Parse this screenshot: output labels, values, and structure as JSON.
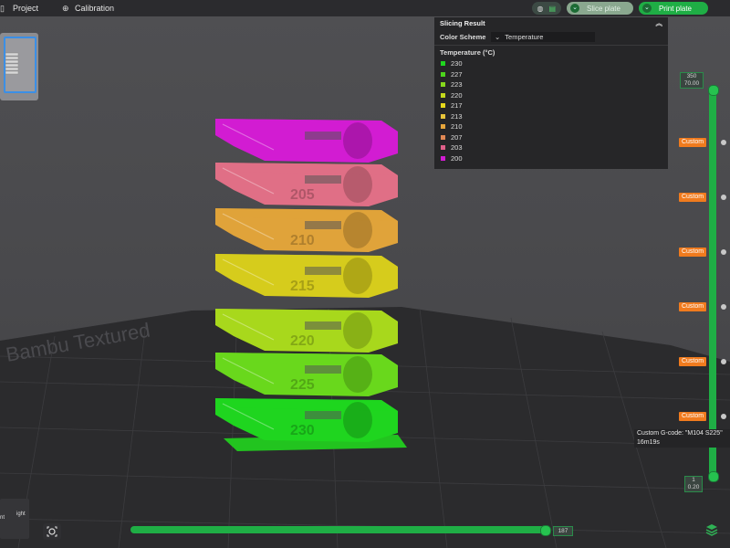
{
  "topbar": {
    "menus": [
      {
        "label": "Project",
        "icon": "folder-icon"
      },
      {
        "label": "Calibration",
        "icon": "calibration-icon"
      }
    ],
    "slice_label": "Slice plate",
    "print_label": "Print plate"
  },
  "panel": {
    "title": "Slicing Result",
    "color_scheme_label": "Color Scheme",
    "color_scheme_value": "Temperature",
    "legend_title": "Temperature (°C)",
    "legend": [
      {
        "label": "230",
        "color": "#1fd51f"
      },
      {
        "label": "227",
        "color": "#4cd41c"
      },
      {
        "label": "223",
        "color": "#86d81c"
      },
      {
        "label": "220",
        "color": "#c4d81c"
      },
      {
        "label": "217",
        "color": "#e6d81c"
      },
      {
        "label": "213",
        "color": "#e8c53a"
      },
      {
        "label": "210",
        "color": "#e6a63c"
      },
      {
        "label": "207",
        "color": "#e08854"
      },
      {
        "label": "203",
        "color": "#e0608a"
      },
      {
        "label": "200",
        "color": "#d21cd2"
      }
    ]
  },
  "layer_slider": {
    "top_value": "350",
    "top_height": "70.00",
    "bottom_value": "1",
    "bottom_height": "0.20",
    "custom_label": "Custom",
    "custom_count": 6
  },
  "tooltip": {
    "line1": "Custom G-code: \"M104 S225\"",
    "line2": "16m19s"
  },
  "move_slider": {
    "value": "187"
  },
  "orient": {
    "a": "nt",
    "b": "ight"
  },
  "model_labels": [
    "230",
    "225",
    "220",
    "215",
    "210",
    "205"
  ]
}
